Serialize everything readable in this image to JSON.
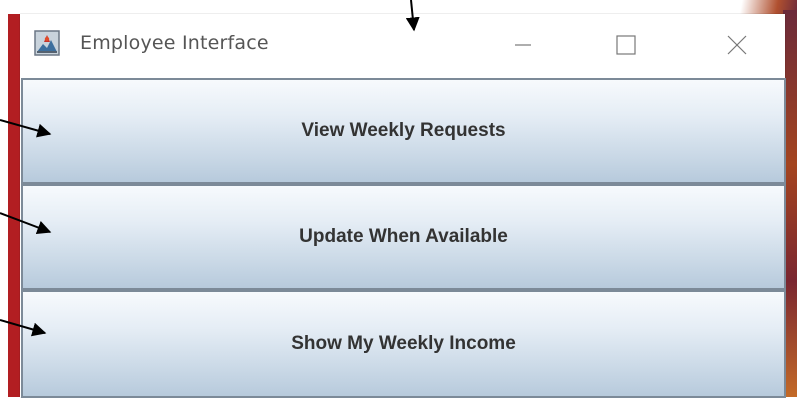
{
  "window": {
    "title": "Employee Interface",
    "controls": [
      "minimize-icon",
      "maximize-icon",
      "close-icon"
    ]
  },
  "buttons": [
    {
      "label": "View Weekly Requests"
    },
    {
      "label": "Update When Available"
    },
    {
      "label": "Show My Weekly Income"
    }
  ],
  "colors": {
    "button_border": "#7c8a98",
    "button_text": "#333333",
    "title_text": "#555555",
    "desktop_left": "#b21e22"
  }
}
